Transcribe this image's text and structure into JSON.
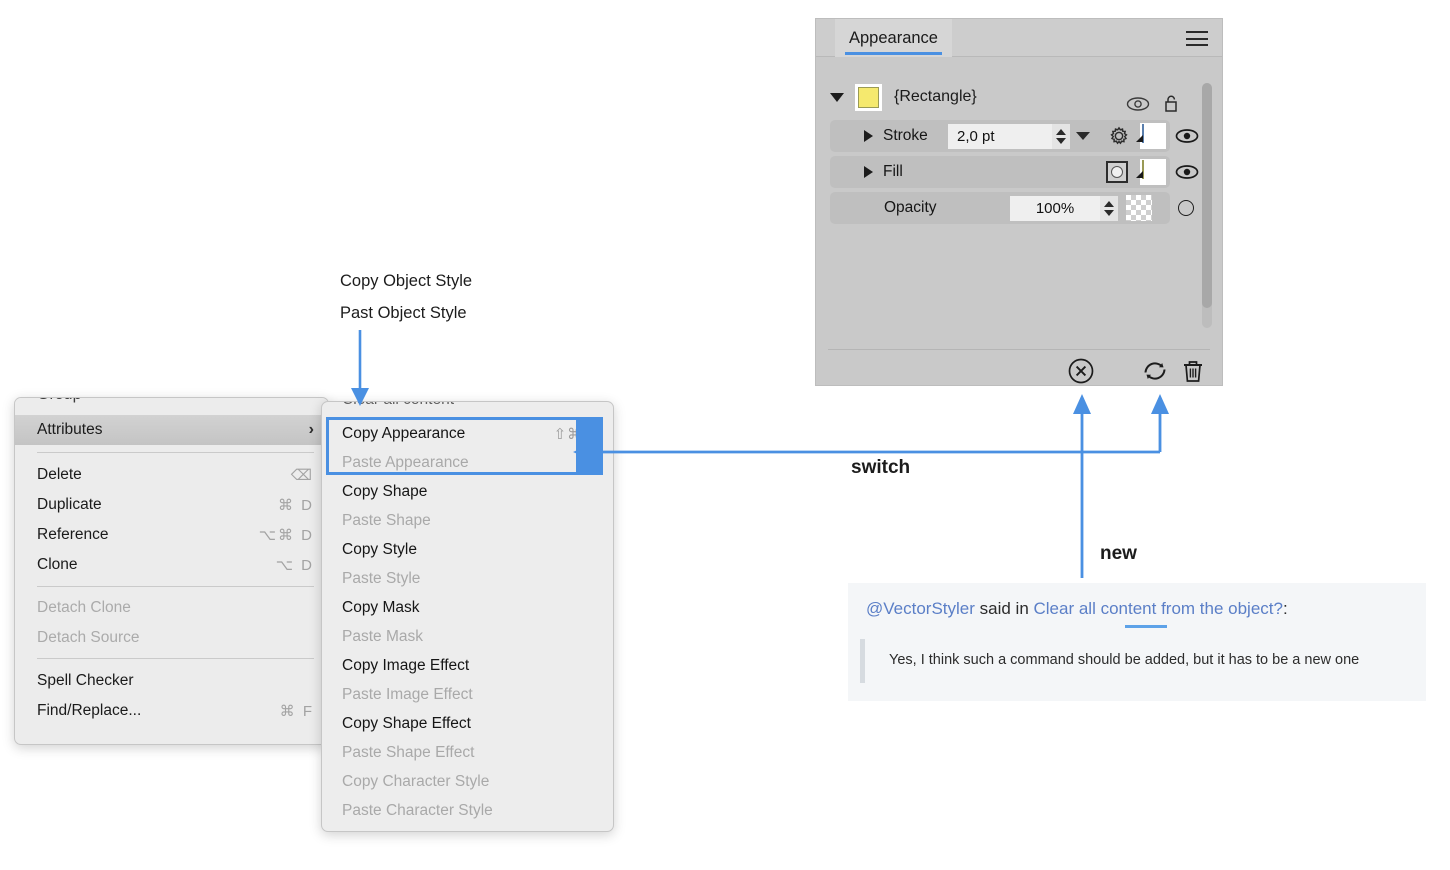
{
  "panel": {
    "tab_label": "Appearance",
    "menu_icon": "hamburger-icon",
    "root": {
      "disclosure": "expanded",
      "swatch_color": "#f5e96e",
      "label": "{Rectangle}",
      "visibility_icon": "eye-icon",
      "lock_icon": "unlock-icon"
    },
    "rows": [
      {
        "name": "Stroke",
        "value": "2,0 pt",
        "swatch_color": "#6a9bd8",
        "gear_icon": "gear-icon",
        "visibility_icon": "eye-icon"
      },
      {
        "name": "Fill",
        "value": "",
        "swatch_color": "#f5e96e",
        "type_icon": "fill-type-icon",
        "visibility_icon": "eye-icon"
      },
      {
        "name": "Opacity",
        "value": "100%",
        "swatch_color": "transparent",
        "visibility_icon": "circle-icon"
      }
    ],
    "footer": {
      "clear_icon": "circle-x-icon",
      "refresh_icon": "refresh-icon",
      "delete_icon": "trash-icon"
    }
  },
  "context_menu": {
    "items": [
      {
        "label": "Attributes",
        "shortcut": "",
        "submenu": "›",
        "state": "highlight",
        "sep_after": true
      },
      {
        "label": "Delete",
        "shortcut": "⌫",
        "state": "normal"
      },
      {
        "label": "Duplicate",
        "shortcut": "⌘ D",
        "state": "normal"
      },
      {
        "label": "Reference",
        "shortcut": "⌥⌘ D",
        "state": "normal"
      },
      {
        "label": "Clone",
        "shortcut": "⌥ D",
        "state": "normal",
        "sep_after": true
      },
      {
        "label": "Detach Clone",
        "shortcut": "",
        "state": "disabled"
      },
      {
        "label": "Detach Source",
        "shortcut": "",
        "state": "disabled",
        "sep_after": true
      },
      {
        "label": "Spell Checker",
        "shortcut": "",
        "state": "normal"
      },
      {
        "label": "Find/Replace...",
        "shortcut": "⌘ F",
        "state": "normal"
      }
    ]
  },
  "submenu": {
    "items": [
      {
        "label": "Copy Appearance",
        "shortcut": "⇧⌘C",
        "state": "normal"
      },
      {
        "label": "Paste Appearance",
        "shortcut": "",
        "state": "disabled"
      },
      {
        "label": "Copy Shape",
        "shortcut": "",
        "state": "normal"
      },
      {
        "label": "Paste Shape",
        "shortcut": "",
        "state": "disabled"
      },
      {
        "label": "Copy Style",
        "shortcut": "",
        "state": "normal"
      },
      {
        "label": "Paste Style",
        "shortcut": "",
        "state": "disabled"
      },
      {
        "label": "Copy Mask",
        "shortcut": "",
        "state": "normal"
      },
      {
        "label": "Paste Mask",
        "shortcut": "",
        "state": "disabled"
      },
      {
        "label": "Copy Image Effect",
        "shortcut": "",
        "state": "normal"
      },
      {
        "label": "Paste Image Effect",
        "shortcut": "",
        "state": "disabled"
      },
      {
        "label": "Copy Shape Effect",
        "shortcut": "",
        "state": "normal"
      },
      {
        "label": "Paste Shape Effect",
        "shortcut": "",
        "state": "disabled"
      },
      {
        "label": "Copy Character Style",
        "shortcut": "",
        "state": "disabled"
      },
      {
        "label": "Paste Character Style",
        "shortcut": "",
        "state": "disabled"
      }
    ]
  },
  "annotations": {
    "copy_object_style": "Copy Object Style",
    "past_object_style": "Past Object Style",
    "switch": "switch",
    "new": "new",
    "accent_color": "#4a90e2"
  },
  "quote": {
    "user": "@VectorStyler",
    "said_in": " said in ",
    "topic": "Clear all content from the object?",
    "colon": ":",
    "body": "Yes, I think such a command should be added, but it has to be a new one"
  }
}
